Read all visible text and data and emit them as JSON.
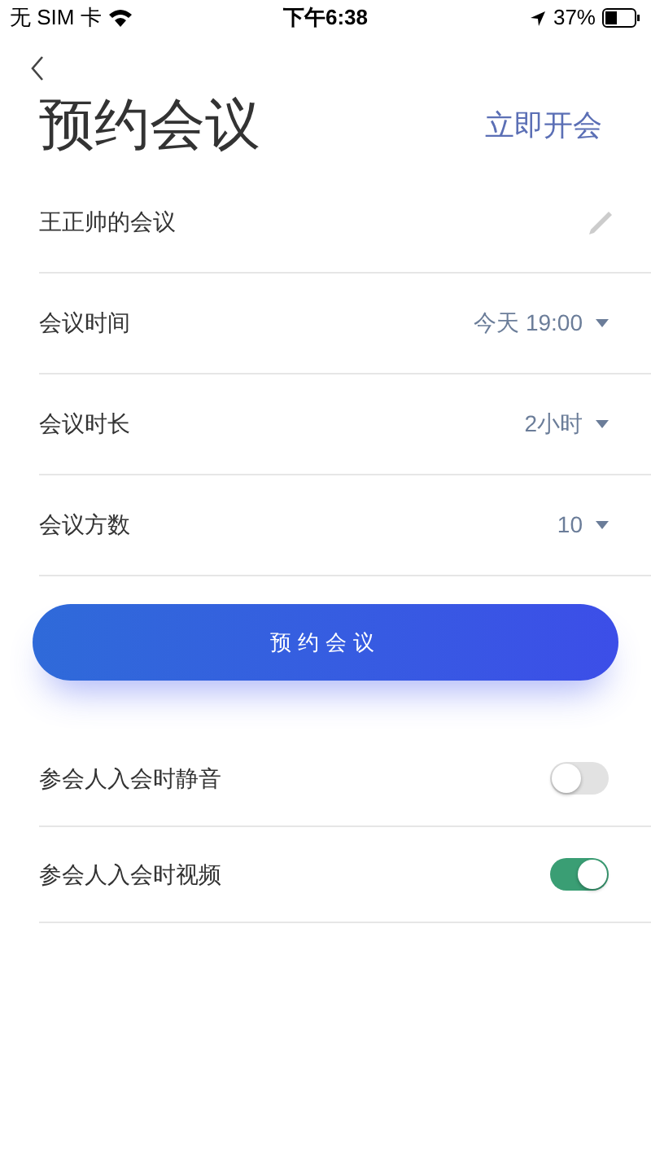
{
  "status_bar": {
    "carrier": "无 SIM 卡",
    "time": "下午6:38",
    "battery": "37%"
  },
  "header": {
    "title": "预约会议",
    "action": "立即开会"
  },
  "meeting_name": {
    "value": "王正帅的会议"
  },
  "settings": [
    {
      "label": "会议时间",
      "value": "今天 19:00"
    },
    {
      "label": "会议时长",
      "value": "2小时"
    },
    {
      "label": "会议方数",
      "value": "10"
    }
  ],
  "submit_button": "预约会议",
  "toggles": [
    {
      "label": "参会人入会时静音",
      "on": false
    },
    {
      "label": "参会人入会时视频",
      "on": true
    }
  ]
}
